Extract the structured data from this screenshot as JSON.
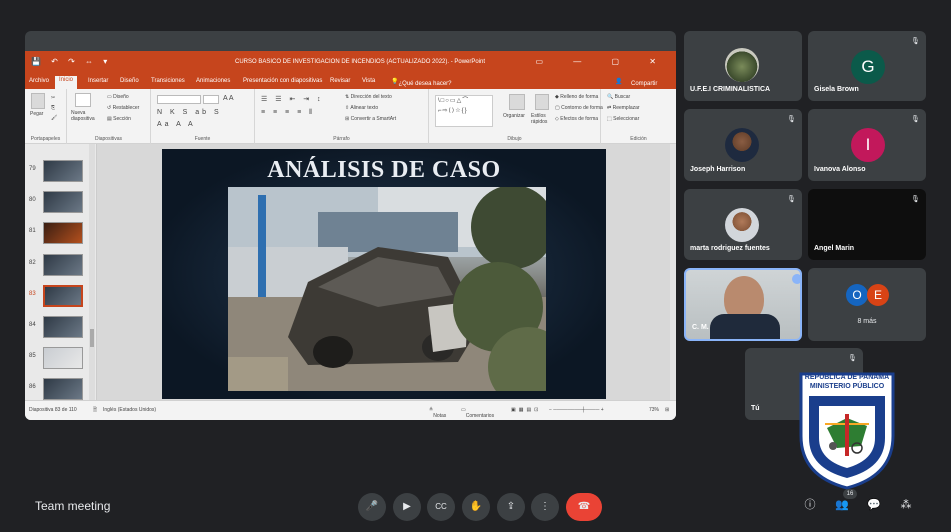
{
  "powerpoint": {
    "quick_access": "💾 ↶ ↷ ⇔ ▾",
    "window_title": "CURSO BASICO DE INVESTIGACION DE INCENDIOS (ACTUALIZADO 2022). - PowerPoint",
    "window_controls": "▭ — ▢ ✕",
    "tabs": [
      "Archivo",
      "Inicio",
      "Insertar",
      "Diseño",
      "Transiciones",
      "Animaciones",
      "Presentación con diapositivas",
      "Revisar",
      "Vista"
    ],
    "active_tab": "Inicio",
    "tell_me": "¿Qué desea hacer?",
    "share": "Compartir",
    "ribbon": {
      "paste": "Pegar",
      "new_slide": "Nueva diapositiva",
      "layout": "Diseño",
      "reset": "Restablecer",
      "section": "Sección",
      "text_direction": "Dirección del texto",
      "align_text": "Alinear texto",
      "smartart": "Convertir a SmartArt",
      "organize": "Organizar",
      "quick_styles": "Estilos rápidos",
      "shape_fill": "Relleno de forma",
      "shape_outline": "Contorno de forma",
      "shape_effects": "Efectos de forma",
      "find": "Buscar",
      "replace": "Reemplazar",
      "select": "Seleccionar",
      "groups": [
        "Portapapeles",
        "Diapositivas",
        "Fuente",
        "Párrafo",
        "Dibujo",
        "Edición"
      ]
    },
    "thumbnails": [
      "79",
      "80",
      "81",
      "82",
      "83",
      "84",
      "85",
      "86"
    ],
    "selected_thumbnail": "83",
    "slide_title": "ANÁLISIS DE CASO",
    "status": {
      "slide_position": "Diapositiva 83 de 110",
      "language": "Inglés (Estados Unidos)",
      "notes": "Notas",
      "comments": "Comentarios",
      "zoom": "73%"
    }
  },
  "participants": [
    {
      "name": "U.F.E.I CRIMINALISTICA",
      "type": "photo",
      "muted": false
    },
    {
      "name": "Gisela Brown",
      "type": "initial",
      "initial": "G",
      "color": "#0b5a4a",
      "muted": true
    },
    {
      "name": "Joseph Harrison",
      "type": "photo",
      "muted": true
    },
    {
      "name": "Ivanova Alonso",
      "type": "initial",
      "initial": "I",
      "color": "#c2185b",
      "muted": true
    },
    {
      "name": "marta rodriguez fuentes",
      "type": "photo",
      "muted": true
    },
    {
      "name": "Angel Marin",
      "type": "dark",
      "muted": true
    },
    {
      "name": "C. M.",
      "type": "video",
      "muted": false,
      "speaking": true
    },
    {
      "name": "Tú",
      "type": "self",
      "muted": true
    }
  ],
  "more_tile": {
    "label": "8 más",
    "avatars": [
      {
        "initial": "O",
        "color": "#1565c0"
      },
      {
        "initial": "E",
        "color": "#d84315"
      }
    ]
  },
  "bottom_bar": {
    "meeting_title": "Team meeting",
    "participant_count": "16"
  },
  "seal": {
    "line1": "REPÚBLICA DE PANAMÁ",
    "line2": "MINISTERIO PÚBLICO",
    "ring_text": "INSTITUTO DE MEDICINA LEGAL Y CIENCIAS FORENSES"
  },
  "colors": {
    "background": "#202124",
    "tile": "#3c4043",
    "ppt_accent": "#c6451d",
    "end_call": "#ea4335",
    "speaking": "#8ab4f8"
  }
}
